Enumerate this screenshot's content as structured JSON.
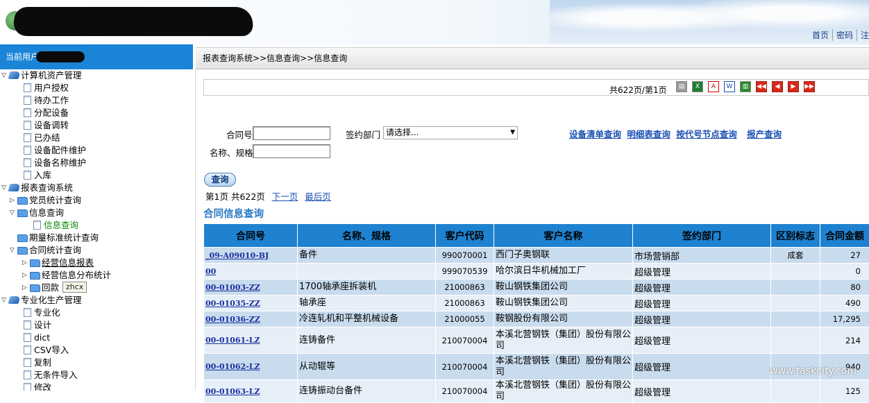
{
  "header": {
    "links": [
      "首页",
      "密码",
      "注"
    ]
  },
  "userbar": {
    "label": "当前用户"
  },
  "sidebar": {
    "items": [
      {
        "label": "计算机资产管理",
        "level": 0,
        "icon": "book-icon",
        "toggle": "expanded"
      },
      {
        "label": "用户授权",
        "level": 2,
        "icon": "doc-icon"
      },
      {
        "label": "待办工作",
        "level": 2,
        "icon": "doc-icon"
      },
      {
        "label": "分配设备",
        "level": 2,
        "icon": "doc-icon"
      },
      {
        "label": "设备调转",
        "level": 2,
        "icon": "doc-icon"
      },
      {
        "label": "已办结",
        "level": 2,
        "icon": "doc-icon"
      },
      {
        "label": "设备配件维护",
        "level": 2,
        "icon": "doc-icon"
      },
      {
        "label": "设备名称维护",
        "level": 2,
        "icon": "doc-icon"
      },
      {
        "label": "入库",
        "level": 2,
        "icon": "doc-icon"
      },
      {
        "label": "报表查询系统",
        "level": 0,
        "icon": "book-icon",
        "toggle": "expanded"
      },
      {
        "label": "党员统计查询",
        "level": 1,
        "icon": "folder-icon",
        "toggle": "collapsed"
      },
      {
        "label": "信息查询",
        "level": 1,
        "icon": "folder-icon",
        "toggle": "expanded"
      },
      {
        "label": "信息查询",
        "level": 3,
        "icon": "doc-icon",
        "selected": true
      },
      {
        "label": "期量标准统计查询",
        "level": 1,
        "icon": "folder-icon",
        "toggle": "none"
      },
      {
        "label": "合同统计查询",
        "level": 1,
        "icon": "folder-icon",
        "toggle": "expanded"
      },
      {
        "label": "经营信息报表",
        "level": 2,
        "icon": "folder-icon",
        "toggle": "collapsed",
        "underline": true
      },
      {
        "label": "经营信息分布统计",
        "level": 2,
        "icon": "folder-icon",
        "toggle": "collapsed"
      },
      {
        "label": "回款",
        "level": 2,
        "icon": "folder-icon",
        "toggle": "collapsed"
      },
      {
        "label": "专业化生产管理",
        "level": 0,
        "icon": "book-icon",
        "toggle": "expanded"
      },
      {
        "label": "专业化",
        "level": 2,
        "icon": "doc-icon"
      },
      {
        "label": "设计",
        "level": 2,
        "icon": "doc-icon"
      },
      {
        "label": "dict",
        "level": 2,
        "icon": "doc-icon"
      },
      {
        "label": "CSV导入",
        "level": 2,
        "icon": "doc-icon"
      },
      {
        "label": "复制",
        "level": 2,
        "icon": "doc-icon"
      },
      {
        "label": "无条件导入",
        "level": 2,
        "icon": "doc-icon"
      },
      {
        "label": "修改",
        "level": 2,
        "icon": "doc-icon"
      }
    ],
    "tooltip": "zhcx"
  },
  "breadcrumb": "报表查询系统>>信息查询>>信息查询",
  "toolbar": {
    "page_info": "共622页/第1页",
    "icons": [
      "print-icon",
      "excel-icon",
      "pdf-icon",
      "word-icon",
      "csv-icon",
      "first-page-icon",
      "prev-page-icon",
      "next-page-icon",
      "last-page-icon"
    ]
  },
  "form": {
    "contract_no_label": "合同号",
    "contract_no_value": "",
    "name_spec_label": "名称、规格",
    "name_spec_value": "",
    "dept_label": "签约部门",
    "dept_select_value": "请选择..."
  },
  "quick_links": [
    "设备清单查询",
    "明细表查询",
    "按代号节点查询",
    "报产查询"
  ],
  "query_button": "查询",
  "pager": {
    "current": "第1页",
    "total": "共622页",
    "next": "下一页",
    "last": "最后页"
  },
  "section_title": "合同信息查询",
  "table": {
    "headers": [
      "合同号",
      "名称、规格",
      "客户代码",
      "客户名称",
      "签约部门",
      "区别标志",
      "合同金额"
    ],
    "rows": [
      [
        "_09-A09010-BJ",
        "备件",
        "990070001",
        "西门子奥钢联",
        "市场营销部",
        "成套",
        "27"
      ],
      [
        "00",
        "",
        "999070539",
        "哈尔滨日华机械加工厂",
        "超级管理",
        "",
        "0"
      ],
      [
        "00-01003-ZZ",
        "1700轴承座拆装机",
        "21000863",
        "鞍山钢铁集团公司",
        "超级管理",
        "",
        "80"
      ],
      [
        "00-01035-ZZ",
        "轴承座",
        "21000863",
        "鞍山钢铁集团公司",
        "超级管理",
        "",
        "490"
      ],
      [
        "00-01036-ZZ",
        "冷连轧机和平整机械设备",
        "21000055",
        "鞍钢股份有限公司",
        "超级管理",
        "",
        "17,295"
      ],
      [
        "00-01061-LZ",
        "连铸备件",
        "210070004",
        "本溪北营钢铁（集团）股份有限公司",
        "超级管理",
        "",
        "214"
      ],
      [
        "00-01062-LZ",
        "从动辊等",
        "210070004",
        "本溪北营钢铁（集团）股份有限公司",
        "超级管理",
        "",
        "940"
      ],
      [
        "00-01063-LZ",
        "连铸振动台备件",
        "210070004",
        "本溪北营钢铁（集团）股份有限公司",
        "超级管理",
        "",
        "125"
      ]
    ]
  },
  "watermark": "www.taskcity.com"
}
